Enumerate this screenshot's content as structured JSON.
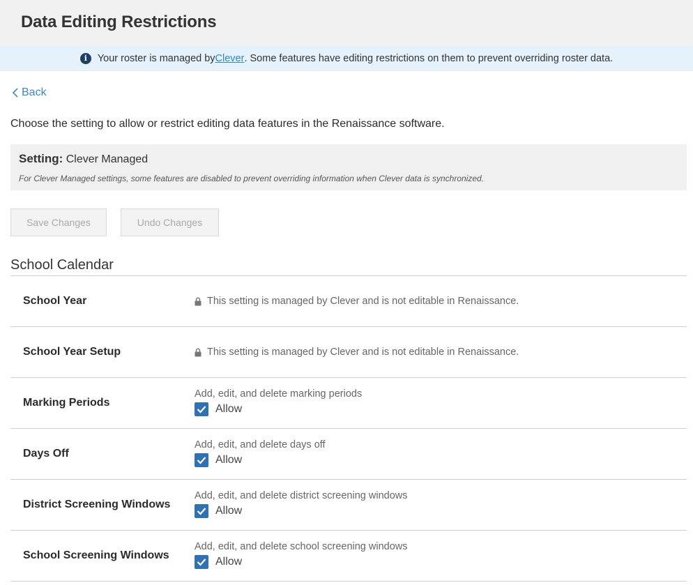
{
  "header": {
    "title": "Data Editing Restrictions"
  },
  "banner": {
    "icon": "info-icon",
    "text_before": "Your roster is managed by ",
    "link_text": "Clever",
    "text_after": ". Some features have editing restrictions on them to prevent overriding roster data."
  },
  "nav": {
    "back_label": "Back"
  },
  "intro": "Choose the setting to allow or restrict editing data features in the Renaissance software.",
  "setting": {
    "label": "Setting:",
    "value": "Clever Managed",
    "note": "For Clever Managed settings, some features are disabled to prevent overriding information when Clever data is synchronized."
  },
  "actions": {
    "save_label": "Save Changes",
    "undo_label": "Undo Changes"
  },
  "section": {
    "title": "School Calendar",
    "rows": [
      {
        "label": "School Year",
        "locked_text": "This setting is managed by Clever and is not editable in Renaissance."
      },
      {
        "label": "School Year Setup",
        "locked_text": "This setting is managed by Clever and is not editable in Renaissance."
      },
      {
        "label": "Marking Periods",
        "description": "Add, edit, and delete marking periods",
        "checkbox_label": "Allow",
        "checked": true
      },
      {
        "label": "Days Off",
        "description": "Add, edit, and delete days off",
        "checkbox_label": "Allow",
        "checked": true
      },
      {
        "label": "District Screening Windows",
        "description": "Add, edit, and delete district screening windows",
        "checkbox_label": "Allow",
        "checked": true
      },
      {
        "label": "School Screening Windows",
        "description": "Add, edit, and delete school screening windows",
        "checkbox_label": "Allow",
        "checked": true
      }
    ]
  },
  "colors": {
    "accent": "#2e71b4",
    "link": "#2f86c6",
    "banner_bg": "#e5f1fb",
    "info_icon": "#1f3e63"
  }
}
